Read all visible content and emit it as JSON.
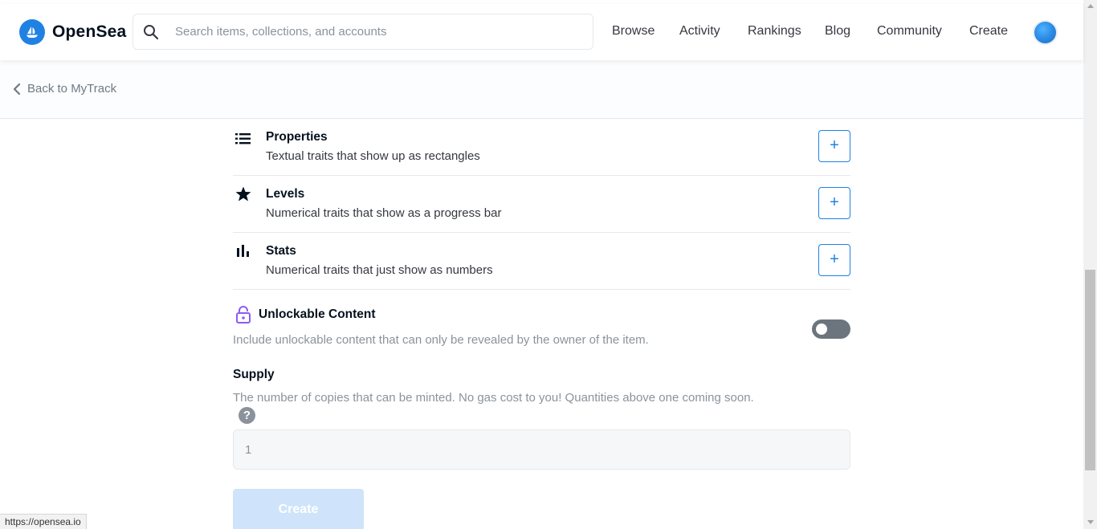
{
  "header": {
    "brand": "OpenSea",
    "search_placeholder": "Search items, collections, and accounts",
    "nav": [
      "Browse",
      "Activity",
      "Rankings",
      "Blog",
      "Community",
      "Create"
    ]
  },
  "back": {
    "label": "Back to MyTrack"
  },
  "traits": [
    {
      "icon": "list-icon",
      "title": "Properties",
      "desc": "Textual traits that show up as rectangles",
      "button": "+"
    },
    {
      "icon": "star-icon",
      "title": "Levels",
      "desc": "Numerical traits that show as a progress bar",
      "button": "+"
    },
    {
      "icon": "bar-chart-icon",
      "title": "Stats",
      "desc": "Numerical traits that just show as numbers",
      "button": "+"
    }
  ],
  "unlockable": {
    "icon": "lock-icon",
    "title": "Unlockable Content",
    "desc": "Include unlockable content that can only be revealed by the owner of the item.",
    "enabled": false
  },
  "supply": {
    "title": "Supply",
    "desc": "The number of copies that can be minted. No gas cost to you! Quantities above one coming soon.",
    "help": "?",
    "value": "1"
  },
  "create_button": "Create",
  "status_bar": {
    "url": "https://opensea.io"
  },
  "colors": {
    "accent": "#2081e2",
    "lock": "#8b5cf6",
    "toggle_off": "#6c757d"
  }
}
